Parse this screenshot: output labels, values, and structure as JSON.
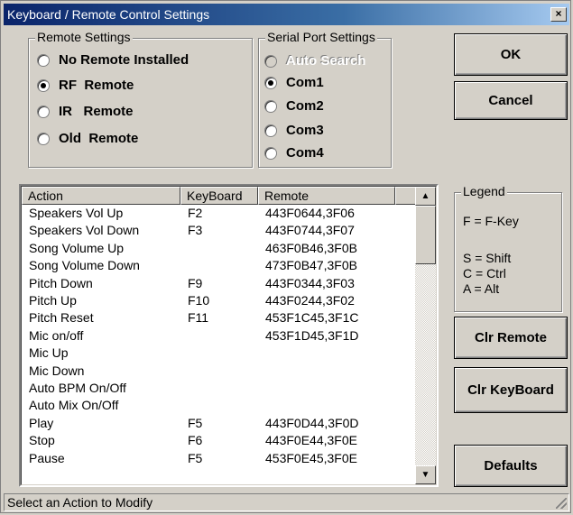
{
  "window": {
    "title": "Keyboard / Remote Control Settings",
    "close_glyph": "×"
  },
  "remote_settings": {
    "label": "Remote Settings",
    "options": [
      {
        "label": "No Remote Installed",
        "selected": false
      },
      {
        "label": "RF  Remote",
        "selected": true
      },
      {
        "label": "IR   Remote",
        "selected": false
      },
      {
        "label": "Old  Remote",
        "selected": false
      }
    ]
  },
  "serial_port": {
    "label": "Serial Port Settings",
    "options": [
      {
        "label": "Auto Search",
        "selected": false,
        "disabled": true
      },
      {
        "label": "Com1",
        "selected": true,
        "disabled": false
      },
      {
        "label": "Com2",
        "selected": false,
        "disabled": false
      },
      {
        "label": "Com3",
        "selected": false,
        "disabled": false
      },
      {
        "label": "Com4",
        "selected": false,
        "disabled": false
      }
    ]
  },
  "buttons": {
    "ok": "OK",
    "cancel": "Cancel",
    "clr_remote": "Clr Remote",
    "clr_keyboard": "Clr KeyBoard",
    "defaults": "Defaults"
  },
  "legend": {
    "label": "Legend",
    "fkey": "F = F-Key",
    "shift": "S = Shift",
    "ctrl": "C = Ctrl",
    "alt": "A = Alt"
  },
  "table": {
    "columns": [
      "Action",
      "KeyBoard",
      "Remote"
    ],
    "rows": [
      [
        "Speakers Vol Up",
        "F2",
        "443F0644,3F06"
      ],
      [
        "Speakers Vol Down",
        "F3",
        "443F0744,3F07"
      ],
      [
        "Song Volume Up",
        "",
        "463F0B46,3F0B"
      ],
      [
        "Song Volume Down",
        "",
        "473F0B47,3F0B"
      ],
      [
        "Pitch Down",
        "F9",
        "443F0344,3F03"
      ],
      [
        "Pitch Up",
        "F10",
        "443F0244,3F02"
      ],
      [
        "Pitch Reset",
        "F11",
        "453F1C45,3F1C"
      ],
      [
        "Mic on/off",
        "",
        "453F1D45,3F1D"
      ],
      [
        "Mic Up",
        "",
        ""
      ],
      [
        "Mic Down",
        "",
        ""
      ],
      [
        "Auto BPM On/Off",
        "",
        ""
      ],
      [
        "Auto Mix On/Off",
        "",
        ""
      ],
      [
        "Play",
        "F5",
        "443F0D44,3F0D"
      ],
      [
        "Stop",
        "F6",
        "443F0E44,3F0E"
      ],
      [
        "Pause",
        "F5",
        "453F0E45,3F0E"
      ]
    ]
  },
  "scrollbar": {
    "up_glyph": "▲",
    "down_glyph": "▼"
  },
  "status": {
    "text": "Select an Action to Modify"
  }
}
